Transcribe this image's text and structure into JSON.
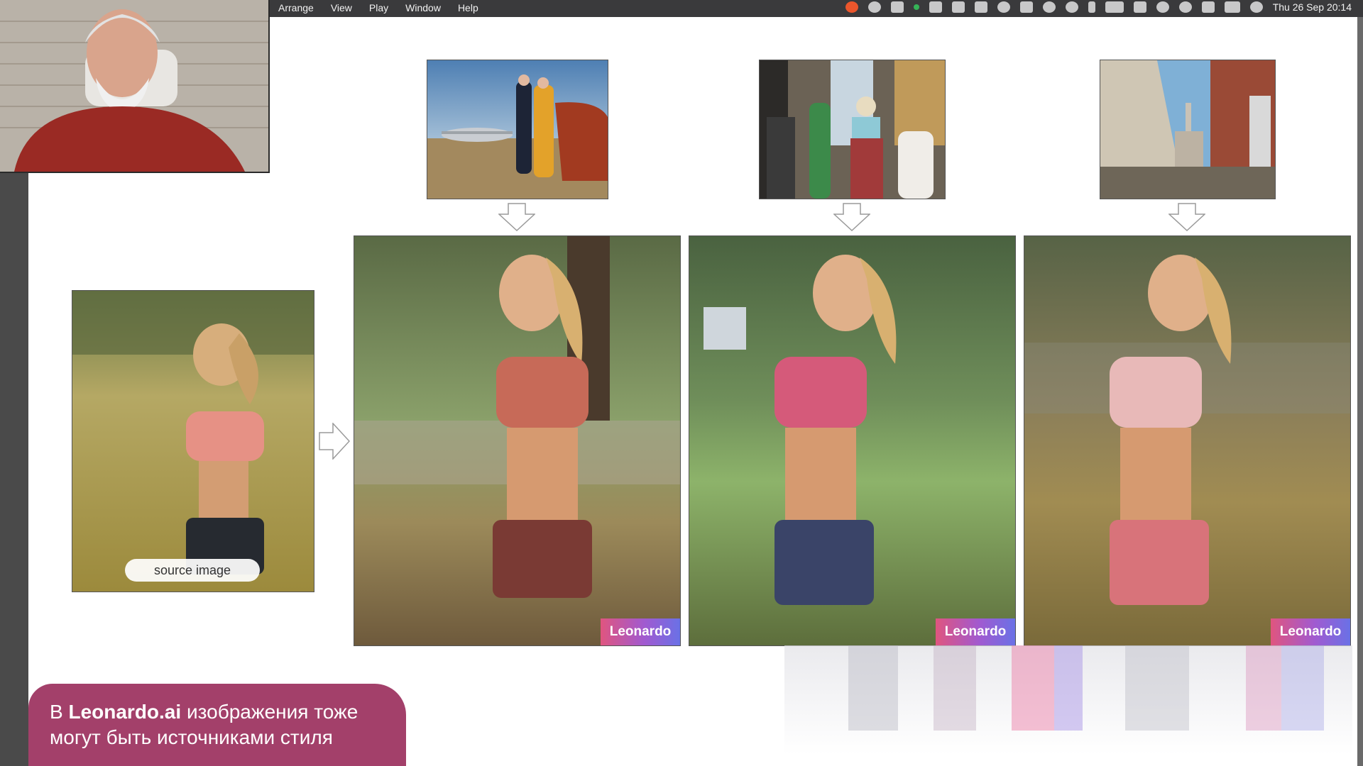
{
  "menubar": {
    "menus": [
      "Arrange",
      "View",
      "Play",
      "Window",
      "Help"
    ],
    "clock": "Thu 26 Sep  20:14",
    "status_icons": [
      "opera-icon",
      "cloud-icon",
      "battery-widget-icon",
      "audio-icon",
      "script-icon",
      "notification-icon",
      "sync-icon",
      "keyboard-icon",
      "location-icon",
      "time-machine-icon",
      "bluetooth-icon",
      "battery-icon",
      "wifi-icon",
      "user-icon",
      "spotlight-icon",
      "input-source-icon",
      "control-center-icon",
      "siri-icon"
    ]
  },
  "slide": {
    "source_label": "source image",
    "badges": [
      "Leonardo",
      "Leonardo",
      "Leonardo"
    ],
    "caption": {
      "prefix": "В ",
      "brand": "Leonardo.ai",
      "line1_rest": " изображения тоже",
      "line2": "могут быть источниками стиля"
    },
    "colors": {
      "caption_bg": "#a3406a",
      "badge_gradient": [
        "#e0557f",
        "#a15ad0",
        "#6a71e6"
      ]
    }
  }
}
